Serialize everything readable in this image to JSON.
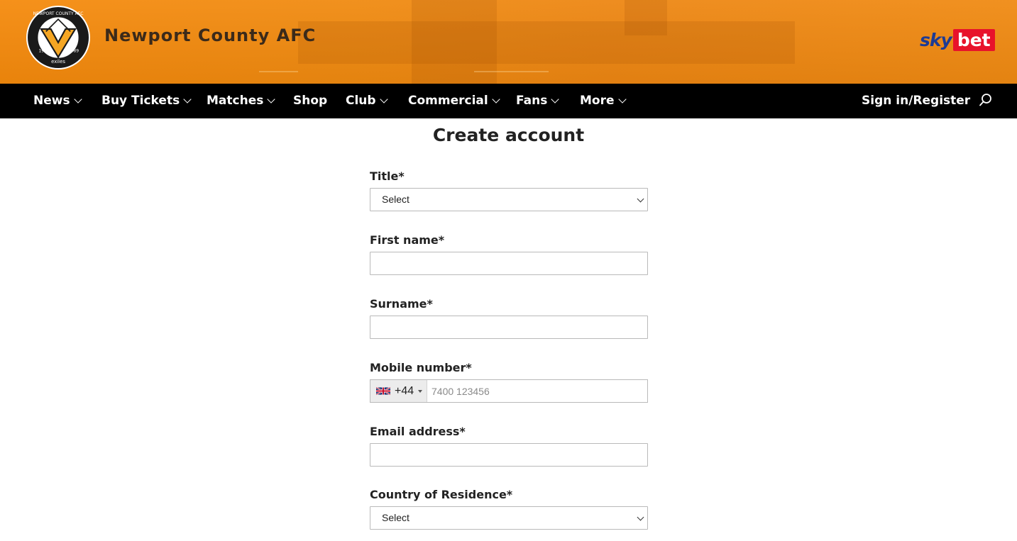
{
  "header": {
    "club_name": "Newport County AFC",
    "crest": {
      "top_text": "NEWPORT COUNTY AFC",
      "year_left": "1912",
      "year_right": "1989",
      "bottom_text": "exiles"
    },
    "sponsor": {
      "part1": "sky",
      "part2": "bet"
    }
  },
  "nav": {
    "items": [
      {
        "label": "News",
        "has_dropdown": true
      },
      {
        "label": "Buy Tickets",
        "has_dropdown": true
      },
      {
        "label": "Matches",
        "has_dropdown": true
      },
      {
        "label": "Shop",
        "has_dropdown": false
      },
      {
        "label": "Club",
        "has_dropdown": true
      },
      {
        "label": "Commercial",
        "has_dropdown": true
      },
      {
        "label": "Fans",
        "has_dropdown": true
      },
      {
        "label": "More",
        "has_dropdown": true
      }
    ],
    "signin": "Sign in/Register",
    "search_icon": "search-icon"
  },
  "form": {
    "title": "Create account",
    "title_field": {
      "label": "Title*",
      "selected": "Select"
    },
    "first_name": {
      "label": "First name*",
      "value": ""
    },
    "surname": {
      "label": "Surname*",
      "value": ""
    },
    "mobile": {
      "label": "Mobile number*",
      "dial_code": "+44",
      "flag": "uk-flag-icon",
      "placeholder": "7400 123456",
      "value": ""
    },
    "email": {
      "label": "Email address*",
      "value": ""
    },
    "country": {
      "label": "Country of Residence*",
      "selected": "Select"
    }
  },
  "colors": {
    "banner": "#f08a10",
    "nav_bg": "#000000",
    "club_name": "#3b2a1a",
    "crest_amber": "#f5a623",
    "sky_blue": "#1d3b94",
    "bet_red": "#e8122b"
  }
}
